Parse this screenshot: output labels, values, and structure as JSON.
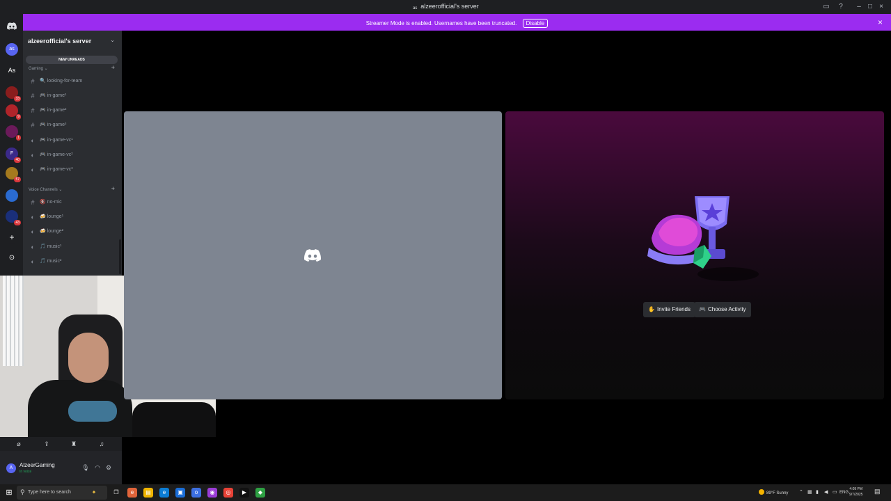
{
  "window": {
    "title": "alzeerofficial's server",
    "server_icon": "as",
    "buttons": [
      "inbox-icon",
      "help-icon",
      "minimize",
      "maximize",
      "close"
    ]
  },
  "streamer_bar": {
    "message": "Streamer Mode is enabled. Usernames have been truncated.",
    "disable_label": "Disable",
    "close_label": "×",
    "color": "#9b2cf0"
  },
  "guild_rail": {
    "home_icon": "discord-icon",
    "items": [
      {
        "label": "as",
        "color": "#5865f2",
        "badge": ""
      },
      {
        "label": "As",
        "color": "#1e1f22",
        "badge": ""
      },
      {
        "label": "",
        "color": "#8a1d1d",
        "badge": "33"
      },
      {
        "label": "",
        "color": "#b0242a",
        "badge": "9"
      },
      {
        "label": "",
        "color": "#6b1a5a",
        "badge": "1"
      },
      {
        "label": "F",
        "color": "#3b2a8a",
        "badge": "40"
      },
      {
        "label": "",
        "color": "#a57a1e",
        "badge": "57"
      },
      {
        "label": "",
        "color": "#2a6bd1",
        "badge": ""
      },
      {
        "label": "",
        "color": "#1a2f7a",
        "badge": "43"
      }
    ],
    "add_label": "+",
    "discover_label": "⊙"
  },
  "channel_panel": {
    "server_name": "alzeerofficial's server",
    "new_unreads": "NEW UNREADS",
    "categories": [
      {
        "name": "Gaming",
        "add": "+"
      },
      {
        "name": "Voice Channels",
        "add": "+"
      }
    ],
    "gaming_channels": [
      {
        "icon": "#",
        "name": "looking-for-team",
        "emoji": "🔍"
      },
      {
        "icon": "#",
        "name": "in-game¹",
        "emoji": "🎮"
      },
      {
        "icon": "#",
        "name": "in-game²",
        "emoji": "🎮"
      },
      {
        "icon": "#",
        "name": "in-game³",
        "emoji": "🎮"
      },
      {
        "icon": "◐",
        "name": "in-game-vc¹",
        "emoji": "🎮"
      },
      {
        "icon": "◐",
        "name": "in-game-vc²",
        "emoji": "🎮"
      },
      {
        "icon": "◐",
        "name": "in-game-vc³",
        "emoji": "🎮"
      }
    ],
    "voice_channels": [
      {
        "icon": "#",
        "name": "no-mic",
        "emoji": "🔇"
      },
      {
        "icon": "◐",
        "name": "lounge¹",
        "emoji": "🍻"
      },
      {
        "icon": "◐",
        "name": "lounge²",
        "emoji": "🍻"
      },
      {
        "icon": "◐",
        "name": "music¹",
        "emoji": "🎵"
      },
      {
        "icon": "◐",
        "name": "music²",
        "emoji": "🎵"
      }
    ]
  },
  "user_controls": [
    "screen-off-icon",
    "screen-share-icon",
    "activity-icon",
    "soundboard-icon"
  ],
  "user": {
    "name": "AlzeerGaming",
    "status": "In voice",
    "avatar_letter": "A"
  },
  "activity": {
    "invite_label": "Invite Friends",
    "choose_label": "Choose Activity"
  },
  "taskbar": {
    "search_placeholder": "Type here to search",
    "weather": "89°F  Sunny",
    "language": "ENG",
    "time": "4:09 PM",
    "date": "9/7/2025"
  }
}
